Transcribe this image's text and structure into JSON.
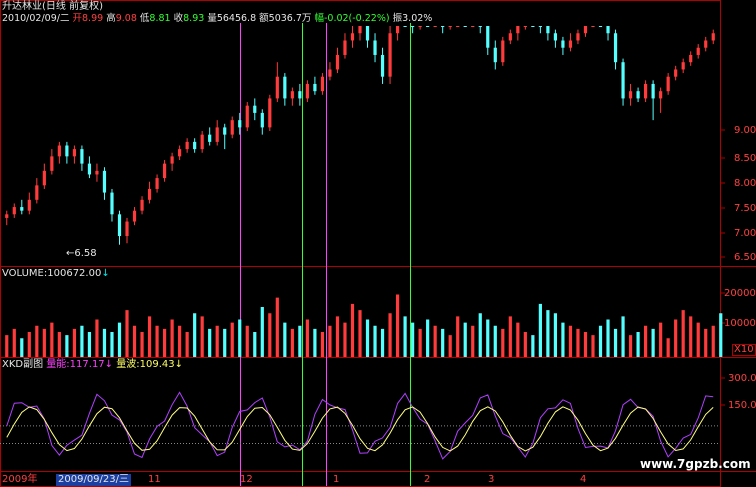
{
  "header": {
    "security": "升达林业(日线 前复权)",
    "date": "2010/02/09/二",
    "open_label": "开",
    "open": "8.99",
    "high_label": "高",
    "high": "9.08",
    "low_label": "低",
    "low": "8.81",
    "close_label": "收",
    "close": "8.93",
    "vol_label": "量",
    "vol": "56456.8",
    "amt_label": "额",
    "amt": "5036.7万",
    "chg_label": "幅",
    "chg": "-0.02(-0.22%)",
    "amp_label": "振",
    "amp": "3.02%"
  },
  "price_panel": {
    "low_marker": "←6.58",
    "yticks": [
      "9.00",
      "8.50",
      "8.00",
      "7.50",
      "7.00",
      "6.50"
    ]
  },
  "volume_panel": {
    "title": "VOLUME:100672.00",
    "arrow": "↓",
    "yticks": [
      "20000",
      "10000"
    ],
    "unit": "X10"
  },
  "indicator_panel": {
    "name": "XKD副图",
    "line1_label": "量能:",
    "line1_value": "117.17",
    "line1_arrow": "↓",
    "line2_label": "量波:",
    "line2_value": "109.43",
    "line2_arrow": "↓",
    "yticks": [
      "300.0",
      "150.0"
    ]
  },
  "xaxis": {
    "labels": [
      "2009年",
      "2009/09/23/三",
      "11",
      "12",
      "1",
      "2",
      "3",
      "4"
    ],
    "watermark": "www.7gpzb.com"
  },
  "colors": {
    "up": "#ff3b3b",
    "down": "#54ffff",
    "frame": "#b00000",
    "magenta": "#ff40ff",
    "green": "#33ff33",
    "yellow": "#ffff80",
    "purple": "#b040ff"
  },
  "chart_data": {
    "type": "candlestick",
    "price_range": [
      6.3,
      9.6
    ],
    "volume_range": [
      0,
      24000
    ],
    "indicator_range": [
      0,
      340
    ],
    "candles": [
      {
        "o": 6.95,
        "c": 7.0,
        "h": 7.05,
        "l": 6.85
      },
      {
        "o": 7.0,
        "c": 7.1,
        "h": 7.15,
        "l": 6.95
      },
      {
        "o": 7.1,
        "c": 7.05,
        "h": 7.2,
        "l": 7.0
      },
      {
        "o": 7.05,
        "c": 7.2,
        "h": 7.3,
        "l": 7.0
      },
      {
        "o": 7.2,
        "c": 7.4,
        "h": 7.5,
        "l": 7.15
      },
      {
        "o": 7.4,
        "c": 7.6,
        "h": 7.7,
        "l": 7.35
      },
      {
        "o": 7.6,
        "c": 7.8,
        "h": 7.9,
        "l": 7.55
      },
      {
        "o": 7.8,
        "c": 7.95,
        "h": 8.0,
        "l": 7.7
      },
      {
        "o": 7.95,
        "c": 7.8,
        "h": 8.0,
        "l": 7.7
      },
      {
        "o": 7.8,
        "c": 7.9,
        "h": 7.95,
        "l": 7.7
      },
      {
        "o": 7.9,
        "c": 7.7,
        "h": 7.95,
        "l": 7.6
      },
      {
        "o": 7.7,
        "c": 7.55,
        "h": 7.8,
        "l": 7.5
      },
      {
        "o": 7.55,
        "c": 7.6,
        "h": 7.7,
        "l": 7.45
      },
      {
        "o": 7.6,
        "c": 7.3,
        "h": 7.65,
        "l": 7.2
      },
      {
        "o": 7.3,
        "c": 7.0,
        "h": 7.35,
        "l": 6.9
      },
      {
        "o": 7.0,
        "c": 6.7,
        "h": 7.05,
        "l": 6.58
      },
      {
        "o": 6.7,
        "c": 6.9,
        "h": 6.95,
        "l": 6.6
      },
      {
        "o": 6.9,
        "c": 7.05,
        "h": 7.1,
        "l": 6.85
      },
      {
        "o": 7.05,
        "c": 7.2,
        "h": 7.25,
        "l": 7.0
      },
      {
        "o": 7.2,
        "c": 7.35,
        "h": 7.45,
        "l": 7.15
      },
      {
        "o": 7.35,
        "c": 7.5,
        "h": 7.55,
        "l": 7.3
      },
      {
        "o": 7.5,
        "c": 7.7,
        "h": 7.75,
        "l": 7.45
      },
      {
        "o": 7.7,
        "c": 7.8,
        "h": 7.85,
        "l": 7.6
      },
      {
        "o": 7.8,
        "c": 7.9,
        "h": 7.95,
        "l": 7.75
      },
      {
        "o": 7.9,
        "c": 8.0,
        "h": 8.05,
        "l": 7.85
      },
      {
        "o": 8.0,
        "c": 7.9,
        "h": 8.05,
        "l": 7.85
      },
      {
        "o": 7.9,
        "c": 8.1,
        "h": 8.15,
        "l": 7.85
      },
      {
        "o": 8.1,
        "c": 8.0,
        "h": 8.2,
        "l": 7.95
      },
      {
        "o": 8.0,
        "c": 8.2,
        "h": 8.3,
        "l": 7.95
      },
      {
        "o": 8.2,
        "c": 8.1,
        "h": 8.25,
        "l": 7.9
      },
      {
        "o": 8.1,
        "c": 8.3,
        "h": 8.35,
        "l": 8.05
      },
      {
        "o": 8.3,
        "c": 8.2,
        "h": 8.4,
        "l": 8.1
      },
      {
        "o": 8.2,
        "c": 8.5,
        "h": 8.55,
        "l": 8.15
      },
      {
        "o": 8.5,
        "c": 8.4,
        "h": 8.6,
        "l": 8.3
      },
      {
        "o": 8.4,
        "c": 8.2,
        "h": 8.45,
        "l": 8.1
      },
      {
        "o": 8.2,
        "c": 8.6,
        "h": 8.65,
        "l": 8.15
      },
      {
        "o": 8.6,
        "c": 8.9,
        "h": 9.1,
        "l": 8.55
      },
      {
        "o": 8.9,
        "c": 8.6,
        "h": 8.95,
        "l": 8.5
      },
      {
        "o": 8.6,
        "c": 8.7,
        "h": 8.75,
        "l": 8.5
      },
      {
        "o": 8.7,
        "c": 8.6,
        "h": 8.8,
        "l": 8.5
      },
      {
        "o": 8.6,
        "c": 8.8,
        "h": 8.85,
        "l": 8.55
      },
      {
        "o": 8.8,
        "c": 8.7,
        "h": 8.9,
        "l": 8.65
      },
      {
        "o": 8.7,
        "c": 8.9,
        "h": 8.95,
        "l": 8.65
      },
      {
        "o": 8.9,
        "c": 9.0,
        "h": 9.1,
        "l": 8.85
      },
      {
        "o": 9.0,
        "c": 9.2,
        "h": 9.3,
        "l": 8.95
      },
      {
        "o": 9.2,
        "c": 9.4,
        "h": 9.5,
        "l": 9.15
      },
      {
        "o": 9.4,
        "c": 9.5,
        "h": 9.6,
        "l": 9.3
      },
      {
        "o": 9.5,
        "c": 9.6,
        "h": 9.8,
        "l": 9.4
      },
      {
        "o": 9.6,
        "c": 9.4,
        "h": 9.7,
        "l": 9.3
      },
      {
        "o": 9.4,
        "c": 9.2,
        "h": 9.5,
        "l": 9.1
      },
      {
        "o": 9.2,
        "c": 8.9,
        "h": 9.3,
        "l": 8.8
      },
      {
        "o": 8.9,
        "c": 9.5,
        "h": 9.6,
        "l": 8.8
      },
      {
        "o": 9.5,
        "c": 10.0,
        "h": 10.1,
        "l": 9.4
      },
      {
        "o": 10.0,
        "c": 9.8,
        "h": 10.2,
        "l": 9.7
      },
      {
        "o": 9.8,
        "c": 9.6,
        "h": 9.9,
        "l": 9.5
      },
      {
        "o": 9.6,
        "c": 9.9,
        "h": 10.0,
        "l": 9.55
      },
      {
        "o": 9.9,
        "c": 9.7,
        "h": 10.0,
        "l": 9.6
      },
      {
        "o": 9.7,
        "c": 9.8,
        "h": 9.9,
        "l": 9.6
      },
      {
        "o": 9.8,
        "c": 9.6,
        "h": 9.85,
        "l": 9.5
      },
      {
        "o": 9.6,
        "c": 9.8,
        "h": 9.9,
        "l": 9.55
      },
      {
        "o": 9.8,
        "c": 9.9,
        "h": 10.0,
        "l": 9.7
      },
      {
        "o": 9.9,
        "c": 9.7,
        "h": 10.0,
        "l": 9.6
      },
      {
        "o": 9.7,
        "c": 9.8,
        "h": 9.9,
        "l": 9.6
      },
      {
        "o": 9.8,
        "c": 9.6,
        "h": 9.85,
        "l": 9.5
      },
      {
        "o": 9.6,
        "c": 9.3,
        "h": 9.65,
        "l": 9.2
      },
      {
        "o": 9.3,
        "c": 9.1,
        "h": 9.4,
        "l": 9.0
      },
      {
        "o": 9.1,
        "c": 9.4,
        "h": 9.45,
        "l": 9.05
      },
      {
        "o": 9.4,
        "c": 9.5,
        "h": 9.55,
        "l": 9.35
      },
      {
        "o": 9.5,
        "c": 9.6,
        "h": 9.65,
        "l": 9.4
      },
      {
        "o": 9.6,
        "c": 9.8,
        "h": 9.85,
        "l": 9.55
      },
      {
        "o": 9.8,
        "c": 9.7,
        "h": 9.9,
        "l": 9.6
      },
      {
        "o": 9.7,
        "c": 9.6,
        "h": 9.75,
        "l": 9.5
      },
      {
        "o": 9.6,
        "c": 9.5,
        "h": 9.65,
        "l": 9.4
      },
      {
        "o": 9.5,
        "c": 9.4,
        "h": 9.55,
        "l": 9.3
      },
      {
        "o": 9.4,
        "c": 9.3,
        "h": 9.45,
        "l": 9.2
      },
      {
        "o": 9.3,
        "c": 9.4,
        "h": 9.5,
        "l": 9.25
      },
      {
        "o": 9.4,
        "c": 9.5,
        "h": 9.55,
        "l": 9.35
      },
      {
        "o": 9.5,
        "c": 9.7,
        "h": 9.75,
        "l": 9.45
      },
      {
        "o": 9.7,
        "c": 9.9,
        "h": 9.95,
        "l": 9.65
      },
      {
        "o": 9.9,
        "c": 9.8,
        "h": 10.0,
        "l": 9.7
      },
      {
        "o": 9.8,
        "c": 9.5,
        "h": 9.85,
        "l": 9.4
      },
      {
        "o": 9.5,
        "c": 9.1,
        "h": 9.55,
        "l": 9.0
      },
      {
        "o": 9.1,
        "c": 8.6,
        "h": 9.15,
        "l": 8.5
      },
      {
        "o": 8.6,
        "c": 8.7,
        "h": 8.8,
        "l": 8.5
      },
      {
        "o": 8.7,
        "c": 8.6,
        "h": 8.75,
        "l": 8.55
      },
      {
        "o": 8.6,
        "c": 8.8,
        "h": 8.85,
        "l": 8.55
      },
      {
        "o": 8.8,
        "c": 8.6,
        "h": 8.85,
        "l": 8.3
      },
      {
        "o": 8.6,
        "c": 8.7,
        "h": 8.75,
        "l": 8.4
      },
      {
        "o": 8.7,
        "c": 8.9,
        "h": 8.95,
        "l": 8.65
      },
      {
        "o": 8.9,
        "c": 9.0,
        "h": 9.05,
        "l": 8.85
      },
      {
        "o": 9.0,
        "c": 9.1,
        "h": 9.15,
        "l": 8.95
      },
      {
        "o": 9.1,
        "c": 9.2,
        "h": 9.25,
        "l": 9.05
      },
      {
        "o": 9.2,
        "c": 9.3,
        "h": 9.35,
        "l": 9.15
      },
      {
        "o": 9.3,
        "c": 9.4,
        "h": 9.45,
        "l": 9.25
      },
      {
        "o": 9.4,
        "c": 9.5,
        "h": 9.55,
        "l": 9.35
      }
    ],
    "volumes": [
      700,
      900,
      600,
      800,
      1000,
      900,
      1100,
      800,
      700,
      900,
      1000,
      800,
      1200,
      900,
      800,
      1100,
      1500,
      1000,
      800,
      1300,
      1000,
      900,
      1200,
      1000,
      800,
      1400,
      1300,
      900,
      1000,
      900,
      1100,
      1200,
      1000,
      800,
      1600,
      1400,
      1900,
      1100,
      900,
      1000,
      1200,
      900,
      800,
      1000,
      1300,
      1100,
      1700,
      1500,
      1200,
      1000,
      900,
      1400,
      2000,
      1300,
      1100,
      900,
      1200,
      1000,
      900,
      700,
      1300,
      1100,
      1000,
      1400,
      1200,
      1000,
      900,
      1300,
      1100,
      800,
      700,
      1700,
      1500,
      1400,
      1100,
      1000,
      900,
      800,
      700,
      1000,
      1200,
      900,
      1300,
      700,
      800,
      1000,
      900,
      1100,
      600,
      1200,
      1500,
      1300,
      1100,
      900,
      1000,
      1400
    ],
    "markers_x": [
      240,
      302,
      326,
      410
    ],
    "marker_colors": [
      "magenta",
      "green",
      "magenta",
      "green"
    ]
  }
}
